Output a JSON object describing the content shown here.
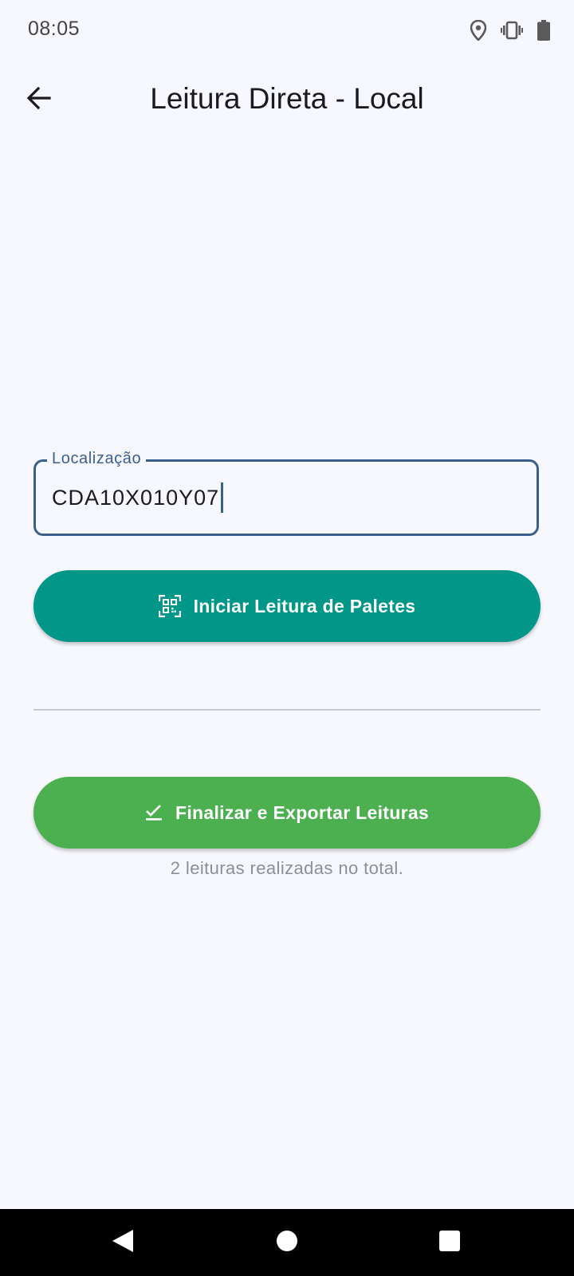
{
  "status_bar": {
    "time": "08:05",
    "icons": [
      "location-icon",
      "vibrate-icon",
      "battery-icon"
    ]
  },
  "app_bar": {
    "back_icon": "arrow-back-icon",
    "title": "Leitura Direta - Local"
  },
  "location_field": {
    "label": "Localização",
    "value": "CDA10X010Y07"
  },
  "scan_button": {
    "icon": "qr-code-scanner-icon",
    "label": "Iniciar Leitura de Paletes",
    "color": "#009688"
  },
  "finish_button": {
    "icon": "done-all-icon",
    "label": "Finalizar e Exportar Leituras",
    "color": "#4caf50"
  },
  "summary_text": "2 leituras realizadas no total.",
  "nav_bar": {
    "icons": [
      "nav-back-icon",
      "nav-home-icon",
      "nav-recents-icon"
    ]
  },
  "colors": {
    "accent": "#3b5f8c",
    "background": "#f7f8fd"
  }
}
